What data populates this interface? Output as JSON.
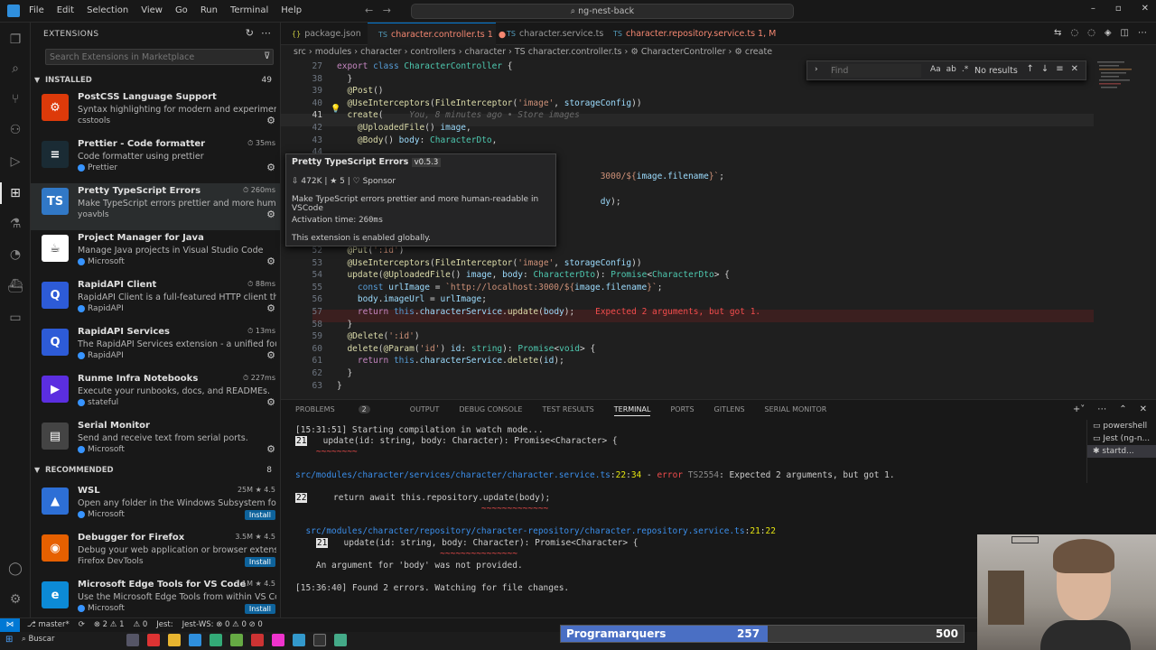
{
  "titlebar": {
    "menu": [
      "File",
      "Edit",
      "Selection",
      "View",
      "Go",
      "Run",
      "Terminal",
      "Help"
    ],
    "command_center": "ng-nest-back"
  },
  "sidebar": {
    "title": "EXTENSIONS",
    "search_placeholder": "Search Extensions in Marketplace",
    "installed_label": "INSTALLED",
    "installed_count": "49",
    "recommended_label": "RECOMMENDED",
    "recommended_count": "8",
    "installed": [
      {
        "name": "PostCSS Language Support",
        "desc": "Syntax highlighting for modern and experimental C...",
        "publisher": "csstools",
        "meta": "",
        "icon_color": "#dd3a0a",
        "icon_text": "⚙"
      },
      {
        "name": "Prettier - Code formatter",
        "desc": "Code formatter using prettier",
        "publisher": "Prettier",
        "meta": "35ms",
        "icon_color": "#1a2b34",
        "icon_text": "≡"
      },
      {
        "name": "Pretty TypeScript Errors",
        "desc": "Make TypeScript errors prettier and more human-r...",
        "publisher": "yoavbls",
        "meta": "260ms",
        "icon_color": "#3178c6",
        "icon_text": "TS"
      },
      {
        "name": "Project Manager for Java",
        "desc": "Manage Java projects in Visual Studio Code",
        "publisher": "Microsoft",
        "meta": "",
        "icon_color": "#ffffff",
        "icon_text": "☕"
      },
      {
        "name": "RapidAPI Client",
        "desc": "RapidAPI Client is a full-featured HTTP client that le...",
        "publisher": "RapidAPI",
        "meta": "88ms",
        "icon_color": "#2d5bd7",
        "icon_text": "Q"
      },
      {
        "name": "RapidAPI Services",
        "desc": "The RapidAPI Services extension - a unified foundat...",
        "publisher": "RapidAPI",
        "meta": "13ms",
        "icon_color": "#2d5bd7",
        "icon_text": "Q"
      },
      {
        "name": "Runme Infra Notebooks",
        "desc": "Execute your runbooks, docs, and READMEs.",
        "publisher": "stateful",
        "meta": "227ms",
        "icon_color": "#5b2ee0",
        "icon_text": "▶"
      },
      {
        "name": "Serial Monitor",
        "desc": "Send and receive text from serial ports.",
        "publisher": "Microsoft",
        "meta": "",
        "icon_color": "#444444",
        "icon_text": "▤"
      }
    ],
    "recommended": [
      {
        "name": "WSL",
        "desc": "Open any folder in the Windows Subsystem for Lin...",
        "publisher": "Microsoft",
        "meta": "25M ★ 4.5",
        "icon_color": "#2d6fd6",
        "icon_text": "🐧",
        "install": "Install"
      },
      {
        "name": "Debugger for Firefox",
        "desc": "Debug your web application or browser extension i...",
        "publisher": "Firefox DevTools",
        "meta": "3.5M ★ 4.5",
        "icon_color": "#e66000",
        "icon_text": "🦊",
        "install": "Install"
      },
      {
        "name": "Microsoft Edge Tools for VS Code",
        "desc": "Use the Microsoft Edge Tools from within VS Code ...",
        "publisher": "Microsoft",
        "meta": "3.1M ★ 4.5",
        "icon_color": "#0c8ad6",
        "icon_text": "e",
        "install": "Install"
      }
    ]
  },
  "tabs": [
    {
      "label": "package.json",
      "state": ""
    },
    {
      "label": "character.controller.ts 1",
      "state": "●"
    },
    {
      "label": "character.service.ts",
      "state": ""
    },
    {
      "label": "character.repository.service.ts 1, M",
      "state": ""
    }
  ],
  "breadcrumb": "src › modules › character › controllers › character › TS character.controller.ts › ⚙ CharacterController › ⚙ create",
  "find": {
    "placeholder": "Find",
    "result": "No results"
  },
  "code_lines": [
    {
      "n": "27",
      "html": "<span class='kw'>export</span> <span class='kw2'>class</span> <span class='ty'>CharacterController</span> {"
    },
    {
      "n": "38",
      "html": "  }"
    },
    {
      "n": "39",
      "html": "  <span class='dec'>@Post</span>()"
    },
    {
      "n": "40",
      "html": "  <span class='dec'>@UseInterceptors</span>(<span class='fn'>FileInterceptor</span>(<span class='str'>'image'</span>, <span class='var'>storageConfig</span>))"
    },
    {
      "n": "41",
      "html": "  <span class='fn'>create</span>(     <span class='ghost'>You, 8 minutes ago • Store images</span>"
    },
    {
      "n": "42",
      "html": "    <span class='dec'>@UploadedFile</span>() <span class='var'>image</span>,"
    },
    {
      "n": "43",
      "html": "    <span class='dec'>@Body</span>() <span class='var'>body</span>: <span class='ty'>CharacterDto</span>,"
    },
    {
      "n": "44",
      "html": ""
    },
    {
      "n": "45",
      "html": ""
    },
    {
      "n": "46",
      "html": "                                                   <span class='str'>3000/${</span><span class='var'>image.filename</span><span class='str'>}`</span>;"
    },
    {
      "n": "47",
      "html": ""
    },
    {
      "n": "48",
      "html": "                                                   <span class='var'>dy</span>);"
    },
    {
      "n": "49",
      "html": ""
    },
    {
      "n": "50",
      "html": ""
    },
    {
      "n": "51",
      "html": ""
    },
    {
      "n": "52",
      "html": "  <span class='dec'>@Put</span>(<span class='str'>':id'</span>)"
    },
    {
      "n": "53",
      "html": "  <span class='dec'>@UseInterceptors</span>(<span class='fn'>FileInterceptor</span>(<span class='str'>'image'</span>, <span class='var'>storageConfig</span>))"
    },
    {
      "n": "54",
      "html": "  <span class='fn'>update</span>(<span class='dec'>@UploadedFile</span>() <span class='var'>image</span>, <span class='var'>body</span>: <span class='ty'>CharacterDto</span>): <span class='ty'>Promise</span>&lt;<span class='ty'>CharacterDto</span>&gt; {"
    },
    {
      "n": "55",
      "html": "    <span class='kw2'>const</span> <span class='var'>urlImage</span> = <span class='str'>`http://localhost:3000/${</span><span class='var'>image.filename</span><span class='str'>}`</span>;"
    },
    {
      "n": "56",
      "html": "    <span class='var'>body</span>.<span class='var'>imageUrl</span> = <span class='var'>urlImage</span>;"
    },
    {
      "n": "57",
      "html": "    <span class='kw'>return</span> <span class='kw2'>this</span>.<span class='var'>characterService</span>.<span class='fn'>update</span>(<span class='var'>body</span>);    <span class='errtext'>Expected 2 arguments, but got 1.</span>"
    },
    {
      "n": "58",
      "html": "  }"
    },
    {
      "n": "59",
      "html": "  <span class='dec'>@Delete</span>(<span class='str'>':id'</span>)"
    },
    {
      "n": "60",
      "html": "  <span class='fn'>delete</span>(<span class='dec'>@Param</span>(<span class='str'>'id'</span>) <span class='var'>id</span>: <span class='ty'>string</span>): <span class='ty'>Promise</span>&lt;<span class='ty'>void</span>&gt; {"
    },
    {
      "n": "61",
      "html": "    <span class='kw'>return</span> <span class='kw2'>this</span>.<span class='var'>characterService</span>.<span class='fn'>delete</span>(<span class='var'>id</span>);"
    },
    {
      "n": "62",
      "html": "  }"
    },
    {
      "n": "63",
      "html": "}"
    }
  ],
  "hover": {
    "title": "Pretty TypeScript Errors",
    "version": "v0.5.3",
    "stats": "472K | ★ 5 | ♡ Sponsor",
    "desc": "Make TypeScript errors prettier and more human-readable in VSCode",
    "activation_label": "Activation time:",
    "activation_value": "260ms",
    "enabled": "This extension is enabled globally."
  },
  "panel": {
    "tabs": [
      "PROBLEMS",
      "OUTPUT",
      "DEBUG CONSOLE",
      "TEST RESULTS",
      "TERMINAL",
      "PORTS",
      "GITLENS",
      "SERIAL MONITOR"
    ],
    "problems_count": "2",
    "active_tab": "TERMINAL",
    "terminals": [
      "powershell",
      "Jest (ng-n...",
      "startd..."
    ]
  },
  "terminal_lines": [
    {
      "html": "[15:31:51] Starting compilation in watch mode..."
    },
    {
      "html": "<span class='tlnum'>21</span>   update(id: string, body: Character): Promise&lt;Character&gt; {"
    },
    {
      "html": "    <span class='squig'>~~~~~~~~</span>"
    },
    {
      "html": "<span class='tpath'>src/modules/character/services/character/character.service.ts</span>:<span class='tyel'>22</span>:<span class='tyel'>34</span> - <span class='tred'>error</span> <span style='color:#888'>TS2554</span>: Expected 2 arguments, but got 1."
    },
    {
      "html": "<span class='tlnum'>22</span>     return await this.repository.update(body);"
    },
    {
      "html": "                                    <span class='squig'>~~~~~~~~~~~~~</span>"
    },
    {
      "html": "  <span class='tpath'>src/modules/character/repository/character-repository/character.repository.service.ts</span>:<span class='tyel'>21</span>:<span class='tyel'>22</span>"
    },
    {
      "html": "    <span class='tlnum'>21</span>   update(id: string, body: Character): Promise&lt;Character&gt; {"
    },
    {
      "html": "                            <span class='squig'>~~~~~~~~~~~~~~~</span>"
    },
    {
      "html": "    An argument for 'body' was not provided."
    },
    {
      "html": "[15:36:40] Found 2 errors. Watching for file changes."
    }
  ],
  "statusbar": [
    "⎇ master*",
    "⟳",
    "⊗ 2 ⚠ 1",
    "⚠ 0",
    "Jest:",
    "Jest-WS: ⊗ 0 ⚠ 0 ⊘ 0"
  ],
  "taskbar": {
    "search": "Buscar"
  },
  "overlay": {
    "label": "Programarquers",
    "current": "257",
    "max": "500",
    "progress_fraction": 0.514
  },
  "colors": {
    "accent": "#0078d4",
    "overlay_fill": "#4a6fc4",
    "error": "#f14c4c"
  }
}
